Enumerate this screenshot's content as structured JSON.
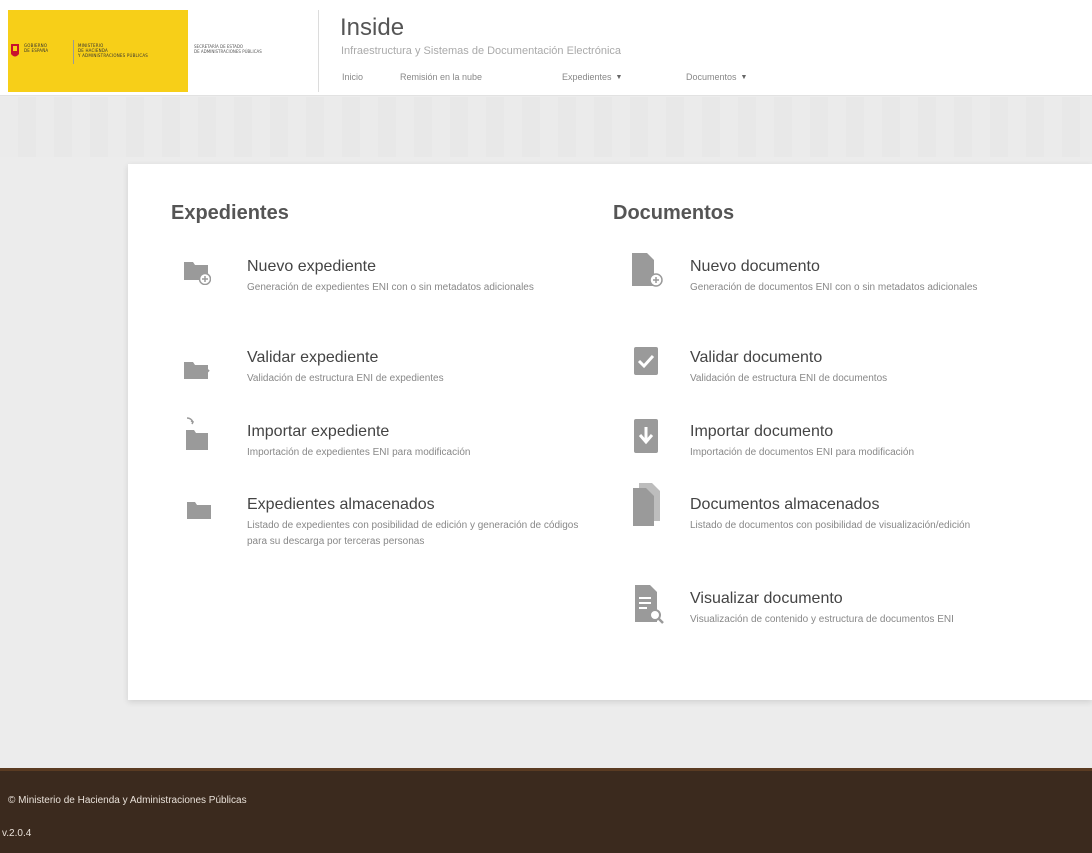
{
  "header": {
    "logo_text_1": "GOBIERNO\nDE ESPAÑA",
    "logo_text_2": "MINISTERIO\nDE HACIENDA\nY ADMINISTRACIONES PÚBLICAS",
    "logo_text_3": "SECRETARÍA DE ESTADO\nDE ADMINISTRACIONES PÚBLICAS",
    "title": "Inside",
    "subtitle": "Infraestructura y Sistemas de Documentación Electrónica"
  },
  "nav": {
    "items": [
      {
        "label": "Inicio"
      },
      {
        "label": "Remisión en la nube"
      },
      {
        "label": "Expedientes",
        "caret": "▼"
      },
      {
        "label": "Documentos",
        "caret": "▼"
      }
    ]
  },
  "expedientes": {
    "title": "Expedientes",
    "items": [
      {
        "title": "Nuevo expediente",
        "desc": "Generación de expedientes ENI con o sin metadatos adicionales",
        "icon": "folder-plus-icon"
      },
      {
        "title": "Validar expediente",
        "desc": "Validación de estructura ENI de expedientes",
        "icon": "folder-check-icon"
      },
      {
        "title": "Importar expediente",
        "desc": "Importación de expedientes ENI para modificación",
        "icon": "folder-import-icon"
      },
      {
        "title": "Expedientes almacenados",
        "desc": "Listado de expedientes con posibilidad de edición y generación de códigos para su descarga por terceras personas",
        "icon": "folder-icon"
      }
    ]
  },
  "documentos": {
    "title": "Documentos",
    "items": [
      {
        "title": "Nuevo documento",
        "desc": "Generación de documentos ENI con o sin metadatos adicionales",
        "icon": "document-plus-icon"
      },
      {
        "title": "Validar documento",
        "desc": "Validación de estructura ENI de documentos",
        "icon": "checkbox-icon"
      },
      {
        "title": "Importar documento",
        "desc": "Importación de documentos ENI para modificación",
        "icon": "download-document-icon"
      },
      {
        "title": "Documentos almacenados",
        "desc": "Listado de documentos con posibilidad de visualización/edición",
        "icon": "documents-stack-icon"
      },
      {
        "title": "Visualizar documento",
        "desc": "Visualización de contenido y estructura de documentos ENI",
        "icon": "document-search-icon"
      }
    ]
  },
  "footer": {
    "copyright": "© Ministerio de Hacienda y Administraciones Públicas",
    "version": "v.2.0.4"
  },
  "colors": {
    "logo_yellow": "#f7cf18",
    "footer_brown": "#3b2a1e",
    "icon_gray": "#9a9a9a"
  }
}
